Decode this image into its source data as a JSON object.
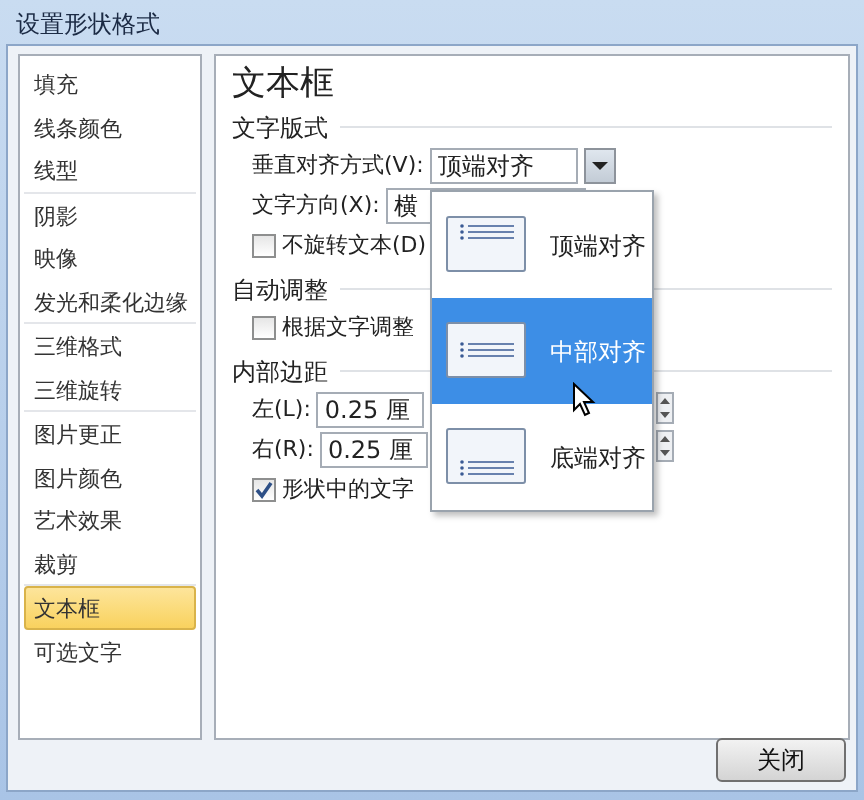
{
  "window": {
    "title": "设置形状格式"
  },
  "sidebar": {
    "groups": [
      [
        {
          "label": "填充",
          "selected": false
        },
        {
          "label": "线条颜色",
          "selected": false
        },
        {
          "label": "线型",
          "selected": false
        }
      ],
      [
        {
          "label": "阴影",
          "selected": false
        },
        {
          "label": "映像",
          "selected": false
        },
        {
          "label": "发光和柔化边缘",
          "selected": false
        }
      ],
      [
        {
          "label": "三维格式",
          "selected": false
        },
        {
          "label": "三维旋转",
          "selected": false
        }
      ],
      [
        {
          "label": "图片更正",
          "selected": false
        },
        {
          "label": "图片颜色",
          "selected": false
        },
        {
          "label": "艺术效果",
          "selected": false
        },
        {
          "label": "裁剪",
          "selected": false
        }
      ],
      [
        {
          "label": "文本框",
          "selected": true
        },
        {
          "label": "可选文字",
          "selected": false
        }
      ]
    ]
  },
  "panel": {
    "title": "文本框",
    "sections": [
      {
        "heading": "文字版式",
        "rows": [
          {
            "kind": "combo",
            "label": "垂直对齐方式(V):",
            "value": "顶端对齐",
            "expanded": true
          },
          {
            "kind": "combo",
            "label": "文字方向(X):",
            "value": "横"
          },
          {
            "kind": "checkbox",
            "label": "不旋转文本(D)",
            "checked": false
          }
        ]
      },
      {
        "heading": "自动调整",
        "rows": [
          {
            "kind": "checkbox",
            "label": "根据文字调整",
            "checked": false
          }
        ]
      },
      {
        "heading": "内部边距",
        "rows": [
          {
            "kind": "spin",
            "label": "左(L):",
            "value": "0.25 厘"
          },
          {
            "kind": "spin",
            "label": "右(R):",
            "value": "0.25 厘"
          },
          {
            "kind": "checkbox",
            "label": "形状中的文字",
            "checked": true
          }
        ]
      }
    ]
  },
  "dropdown": {
    "options": [
      {
        "kind": "top",
        "label": "顶端对齐",
        "selected": false
      },
      {
        "kind": "middle",
        "label": "中部对齐",
        "selected": true
      },
      {
        "kind": "bottom",
        "label": "底端对齐",
        "selected": false
      }
    ]
  },
  "buttons": [
    "关闭"
  ]
}
